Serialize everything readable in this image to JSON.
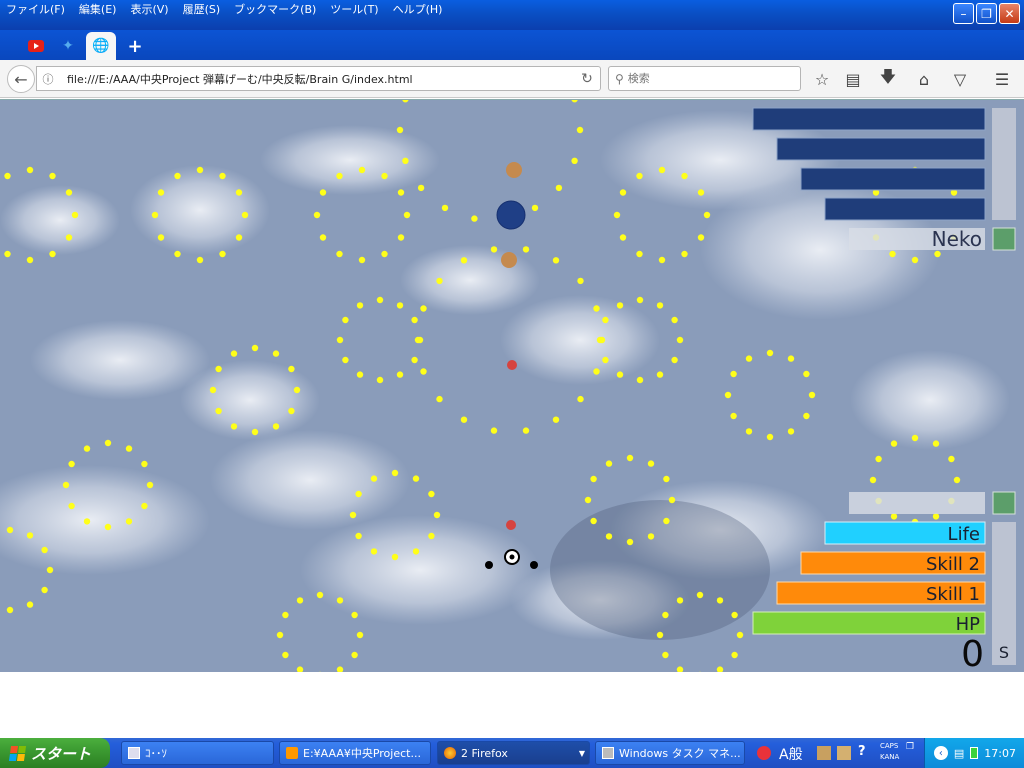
{
  "menu": [
    "ファイル(F)",
    "編集(E)",
    "表示(V)",
    "履歴(S)",
    "ブックマーク(B)",
    "ツール(T)",
    "ヘルプ(H)"
  ],
  "toolbar": {
    "url": "file:///E:/AAA/中央Project  弾幕げーむ/中央反転/Brain G/index.html",
    "search_placeholder": "検索"
  },
  "game": {
    "player_name": "Neko",
    "bars": {
      "life": "Life",
      "skill2": "Skill 2",
      "skill1": "Skill 1",
      "hp": "HP"
    },
    "score": "0",
    "rank": "S",
    "colors": {
      "top_bar": "#1f3d7a",
      "life": "#20d0ff",
      "skill": "#ff8a0a",
      "hp": "#7fd23a",
      "bullet": "#ffff1a",
      "green_box": "#5c9e6a"
    }
  },
  "taskbar": {
    "start": "スタート",
    "tasks": [
      "ｺ･･ｿ",
      "E:¥AAA¥中央Project...",
      "2 Firefox",
      "Windows タスク マネ..."
    ],
    "ime": "A般",
    "caps": "CAPS",
    "kana": "KANA",
    "clock": "17:07"
  }
}
